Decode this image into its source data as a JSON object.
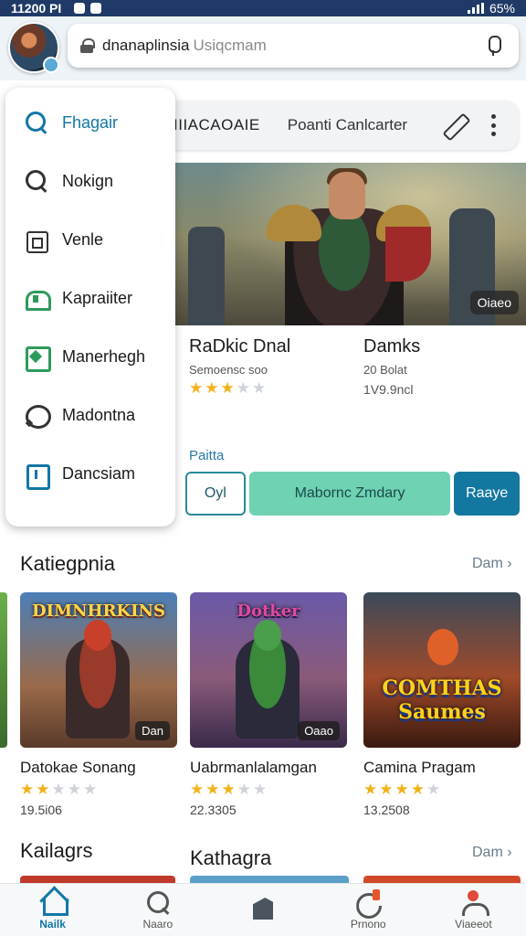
{
  "status_bar": {
    "time": "11200 PI",
    "battery": "65%"
  },
  "search": {
    "query": "dnanaplinsia",
    "placeholder": "Usiqcmam"
  },
  "toolbar": {
    "label_left": "IIIACAOAIE",
    "label_right": "Poanti Canlcarter"
  },
  "side_menu": {
    "items": [
      {
        "label": "Fhagair",
        "icon": "search-icon",
        "active": true
      },
      {
        "label": "Nokign",
        "icon": "search-icon"
      },
      {
        "label": "Venle",
        "icon": "store-icon"
      },
      {
        "label": "Kapraiiter",
        "icon": "category-icon"
      },
      {
        "label": "Manerhegh",
        "icon": "manager-icon"
      },
      {
        "label": "Madontna",
        "icon": "chat-icon"
      },
      {
        "label": "Dancsiam",
        "icon": "info-icon"
      }
    ]
  },
  "hero": {
    "badge": "Oiaeo"
  },
  "featured": {
    "title": "RaDkic Dnal",
    "subtitle": "Semoensc soo",
    "rating": 3,
    "title2": "Damks",
    "subtitle2": "20 Bolat",
    "price2": "1V9.9ncl"
  },
  "pills": {
    "label": "Paitta",
    "a": "Oyl",
    "b": "Mabornc Zmdary",
    "c": "Raaye"
  },
  "section1": {
    "title": "Katiegpnia",
    "link": "Dam"
  },
  "cards": [
    {
      "banner": "DIMNHRKINS",
      "tag": "Dan",
      "name": "Datokae Sonang",
      "rating": 2,
      "count": "19.5i06"
    },
    {
      "banner": "Dotker",
      "tag": "Oaao",
      "name": "Uabrmanlalamgan",
      "rating": 3,
      "count": "22.3305"
    },
    {
      "banner": "COMTHAS Saumes",
      "tag": "",
      "name": "Camina Pragam",
      "rating": 4,
      "count": "13.2508"
    }
  ],
  "section2": {
    "title_left": "Kailagrs",
    "title_right": "Kathagra",
    "link": "Dam"
  },
  "bottom_nav": [
    {
      "label": "Nailk",
      "icon": "home-icon",
      "active": true
    },
    {
      "label": "Naaro",
      "icon": "search-icon"
    },
    {
      "label": "",
      "icon": "games-icon"
    },
    {
      "label": "Prnono",
      "icon": "apps-icon"
    },
    {
      "label": "Viaeeot",
      "icon": "profile-icon"
    }
  ],
  "colors": {
    "accent": "#1377a6",
    "star": "#f1b21a",
    "mint": "#6fd2b3",
    "status_bar": "#1f3a66"
  }
}
